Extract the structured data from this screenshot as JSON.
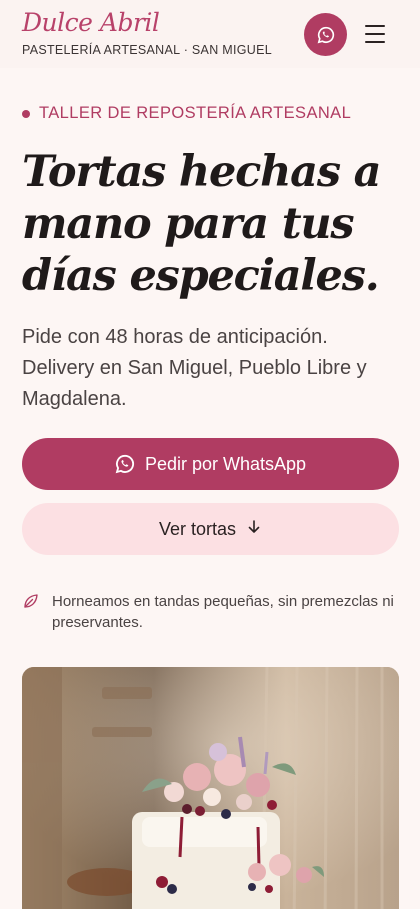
{
  "header": {
    "brand": "Dulce Abril",
    "tagline": "PASTELERÍA ARTESANAL · SAN MIGUEL",
    "whatsapp_icon": "whatsapp-icon",
    "menu_icon": "hamburger-menu-icon"
  },
  "hero": {
    "eyebrow": "TALLER DE REPOSTERÍA ARTESANAL",
    "headline": "Tortas hechas a mano para tus días especiales.",
    "lead": "Pide con 48 horas de anticipación. Delivery en San Miguel, Pueblo Libre y Magdalena.",
    "primary_cta": "Pedir por WhatsApp",
    "secondary_cta": "Ver tortas",
    "secondary_icon": "arrow-down-icon",
    "note": "Horneamos en tandas pequeñas, sin premezclas ni preservantes.",
    "note_icon": "leaf-icon",
    "image": "cake-photo"
  },
  "colors": {
    "accent": "#b03c62",
    "brand": "#b8426a",
    "secondary_bg": "#fce0e3",
    "page_bg": "#fdf6f4"
  }
}
